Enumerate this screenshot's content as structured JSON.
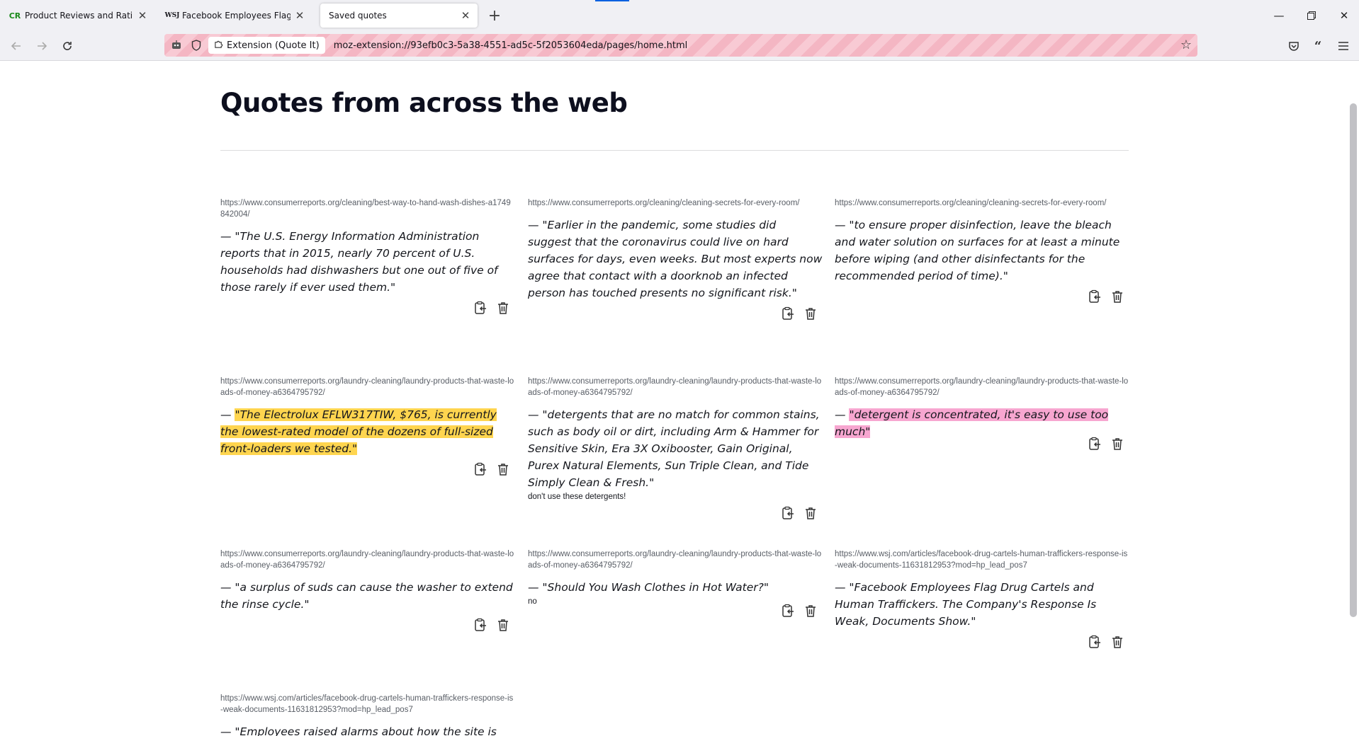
{
  "browser": {
    "tabs": [
      {
        "favicon": "CR",
        "label": "Product Reviews and Ratings -",
        "active": false
      },
      {
        "favicon": "WSJ",
        "label": "Facebook Employees Flag Drug",
        "active": false
      },
      {
        "favicon": "",
        "label": "Saved quotes",
        "active": true
      }
    ],
    "url_chip": "Extension (Quote It)",
    "url": "moz-extension://93efb0c3-5a38-4551-ad5c-5f2053604eda/pages/home.html"
  },
  "page": {
    "title": "Quotes from across the web"
  },
  "quotes": [
    {
      "source": "https://www.consumerreports.org/cleaning/best-way-to-hand-wash-dishes-a1749842004/",
      "text": "— \"The U.S. Energy Information Administration reports that in 2015, nearly 70 percent of U.S. households had dishwashers but one out of five of those rarely if ever used them.\"",
      "note": ""
    },
    {
      "source": "https://www.consumerreports.org/cleaning/cleaning-secrets-for-every-room/",
      "text": "— \"Earlier in the pandemic, some studies did suggest that the coronavirus could live on hard surfaces for days, even weeks. But most experts now agree that contact with a doorknob an infected person has touched presents no significant risk.\"",
      "note": ""
    },
    {
      "source": "https://www.consumerreports.org/cleaning/cleaning-secrets-for-every-room/",
      "text": "— \"to ensure proper disinfection, leave the bleach and water solution on surfaces for at least a minute before wiping (and other disinfectants for the recommended period of time).\"",
      "note": ""
    },
    {
      "source": "https://www.consumerreports.org/laundry-cleaning/laundry-products-that-waste-loads-of-money-a6364795792/",
      "prefix": "— ",
      "highlight": "\"The Electrolux EFLW317TIW, $765, is currently the lowest-rated model of the dozens of full-sized front-loaders we tested.\"",
      "highlight_color": "#ffd54f",
      "note": ""
    },
    {
      "source": "https://www.consumerreports.org/laundry-cleaning/laundry-products-that-waste-loads-of-money-a6364795792/",
      "text": "— \"detergents that are no match for common stains, such as body oil or dirt, including Arm & Hammer for Sensitive Skin, Era 3X Oxibooster, Gain Original, Purex Natural Elements, Sun Triple Clean, and Tide Simply Clean & Fresh.\"",
      "note": "don't use these detergents!"
    },
    {
      "source": "https://www.consumerreports.org/laundry-cleaning/laundry-products-that-waste-loads-of-money-a6364795792/",
      "prefix": "— ",
      "highlight": "\"detergent is concentrated, it's easy to use too much\"",
      "highlight_color": "#f7a6d0",
      "note": ""
    },
    {
      "source": "https://www.consumerreports.org/laundry-cleaning/laundry-products-that-waste-loads-of-money-a6364795792/",
      "text": "— \"a surplus of suds can cause the washer to extend the rinse cycle.\"",
      "note": ""
    },
    {
      "source": "https://www.consumerreports.org/laundry-cleaning/laundry-products-that-waste-loads-of-money-a6364795792/",
      "text": "— \"Should You Wash Clothes in Hot Water?\"",
      "note": "no"
    },
    {
      "source": "https://www.wsj.com/articles/facebook-drug-cartels-human-traffickers-response-is-weak-documents-11631812953?mod=hp_lead_pos7",
      "text": "— \"Facebook Employees Flag Drug Cartels and Human Traffickers. The Company's Response Is Weak, Documents Show.\"",
      "note": ""
    },
    {
      "source": "https://www.wsj.com/articles/facebook-drug-cartels-human-traffickers-response-is-weak-documents-11631812953?mod=hp_lead_pos7",
      "text": "— \"Employees raised alarms about how the site is used in",
      "note": ""
    }
  ],
  "icons": {
    "copy": "clipboard-copy-icon",
    "delete": "trash-icon"
  }
}
